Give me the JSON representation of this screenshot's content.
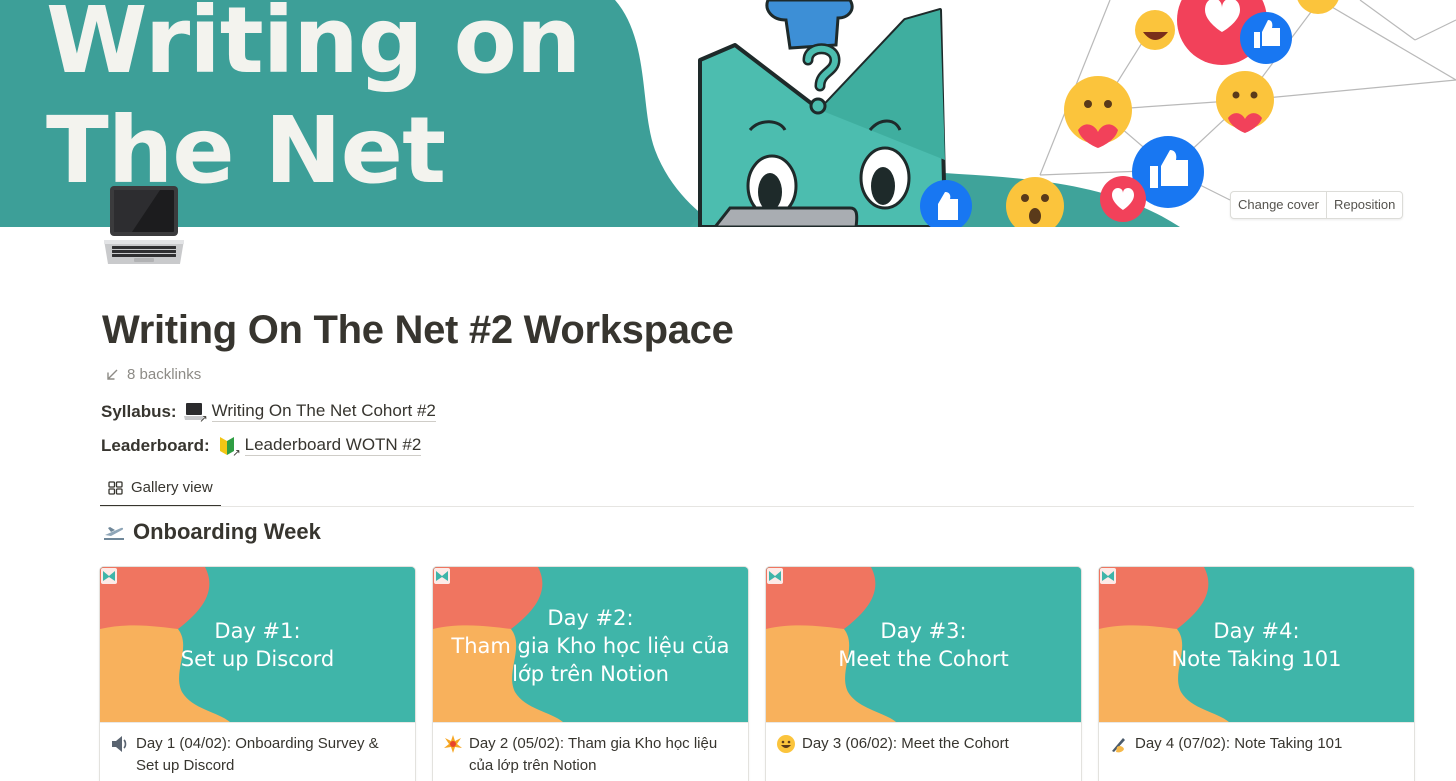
{
  "cover": {
    "title_line1": "Writing on",
    "title_line2": "The Net",
    "change_cover_label": "Change cover",
    "reposition_label": "Reposition",
    "colors": {
      "teal": "#3a9d97",
      "teal_light": "#47c1b2",
      "mascot": "#4cbdaf"
    }
  },
  "page": {
    "icon": "laptop-icon",
    "title": "Writing On The Net #2 Workspace",
    "backlinks": "8 backlinks",
    "properties": [
      {
        "label": "Syllabus:",
        "icon": "laptop-link-icon",
        "link": "Writing On The Net Cohort #2"
      },
      {
        "label": "Leaderboard:",
        "icon": "beginner-badge-icon",
        "link": "Leaderboard WOTN #2"
      }
    ],
    "view": {
      "icon": "gallery-grid-icon",
      "label": "Gallery view"
    },
    "group": {
      "icon": "airplane-departure-icon",
      "title": "Onboarding Week"
    }
  },
  "cards": [
    {
      "cover_lines": [
        "Day #1:",
        "Set up Discord"
      ],
      "emoji": "speaker-icon",
      "title": "Day 1 (04/02): Onboarding Survey & Set up Discord"
    },
    {
      "cover_lines": [
        "Day #2:",
        "Tham gia Kho học liệu của",
        "lớp trên Notion"
      ],
      "emoji": "collision-icon",
      "title": "Day 2 (05/02): Tham gia Kho học liệu của lớp trên Notion"
    },
    {
      "cover_lines": [
        "Day #3:",
        "Meet the Cohort"
      ],
      "emoji": "grinning-face-icon",
      "title": "Day 3 (06/02): Meet the Cohort"
    },
    {
      "cover_lines": [
        "Day #4:",
        "Note Taking 101"
      ],
      "emoji": "writing-hand-icon",
      "title": "Day 4 (07/02): Note Taking 101"
    }
  ]
}
